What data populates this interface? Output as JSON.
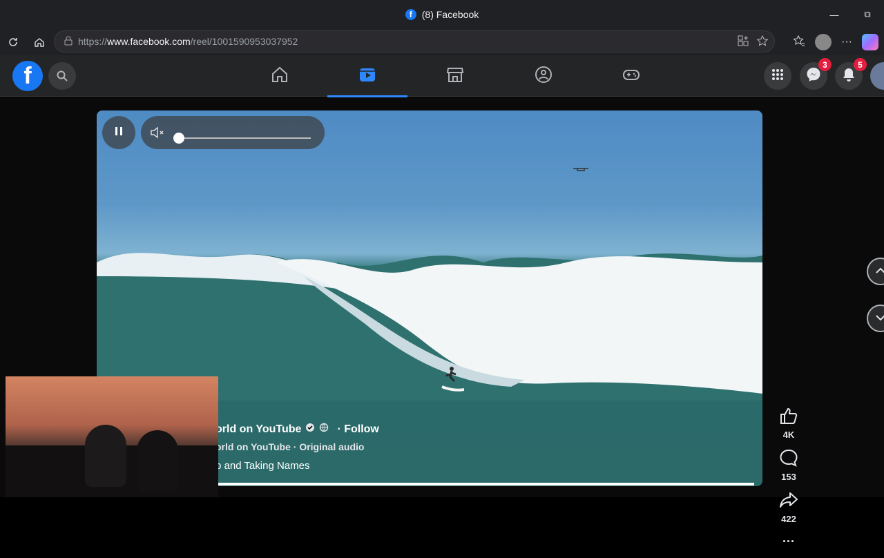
{
  "window": {
    "title": "(8) Facebook",
    "url_prefix": "https://",
    "url_host": "www.facebook.com",
    "url_path": "/reel/1001590953037952"
  },
  "fbnav": {
    "logo": "f",
    "messenger_badge": "3",
    "notifications_badge": "5"
  },
  "reel": {
    "author": "orld on YouTube",
    "follow": "· Follow",
    "audio": "orld on YouTube · Original audio",
    "caption": "p and Taking Names",
    "progress": 1.0
  },
  "actions": {
    "likes": "4K",
    "comments": "153",
    "shares": "422",
    "more": "···"
  },
  "colors": {
    "accent": "#2d88ff",
    "brand": "#1877f2",
    "badge": "#e41e3f"
  }
}
